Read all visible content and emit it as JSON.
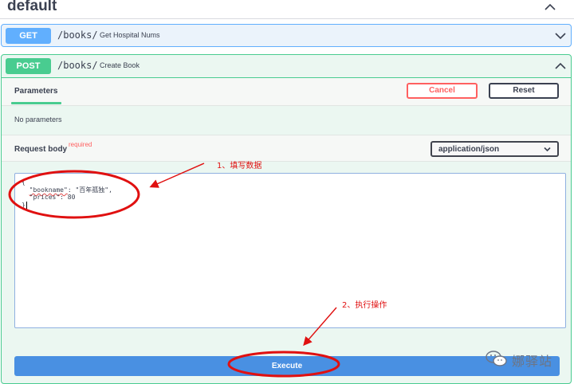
{
  "section": {
    "title": "default"
  },
  "operations": [
    {
      "method": "GET",
      "path": "/books/",
      "summary": "Get Hospital Nums"
    },
    {
      "method": "POST",
      "path": "/books/",
      "summary": "Create Book"
    }
  ],
  "params": {
    "tab_label": "Parameters",
    "cancel_label": "Cancel",
    "reset_label": "Reset",
    "empty_text": "No parameters"
  },
  "request_body": {
    "label": "Request body",
    "required_label": "required",
    "content_type": "application/json",
    "code": {
      "line1": "{",
      "line2_indent": "  ",
      "key_bookname": "\"bookname\"",
      "line2_rest": ": \"百年孤独\",",
      "line3": "  \"prices\": 80",
      "line4": "}"
    }
  },
  "execute_label": "Execute",
  "annotations": {
    "step1": "1、填写数据",
    "step2": "2、执行操作",
    "color": "#e01010"
  },
  "watermark": {
    "text": "娜驿站"
  },
  "colors": {
    "get": "#61affe",
    "post": "#49cc90",
    "execute": "#4990e2",
    "cancel": "#ff6060"
  }
}
